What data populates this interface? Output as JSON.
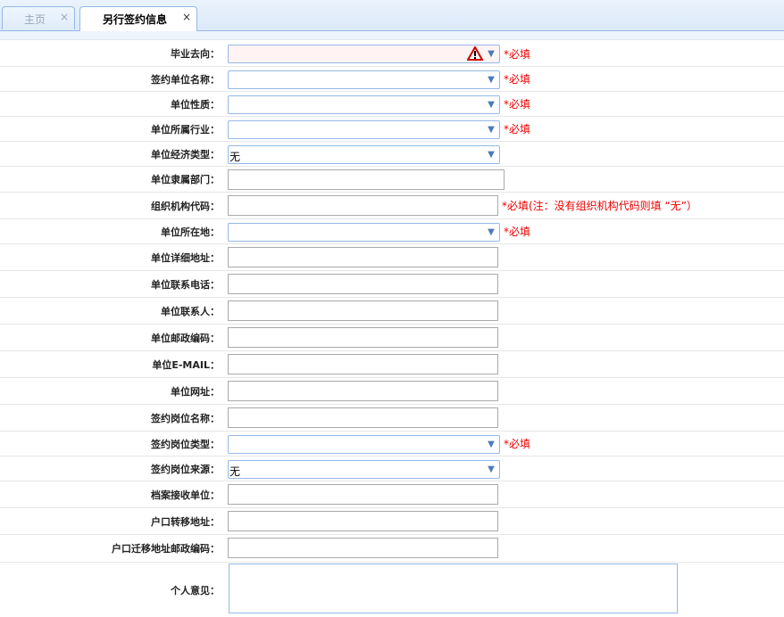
{
  "tabs": [
    {
      "label": "主页",
      "close": "×"
    },
    {
      "label": "另行签约信息",
      "close": "×"
    }
  ],
  "required_text": "*必填",
  "org_code_note": "*必填(注：没有组织机构代码则填 “无”）",
  "fields": {
    "destination": {
      "label": "毕业去向："
    },
    "company_name": {
      "label": "签约单位名称："
    },
    "company_nature": {
      "label": "单位性质："
    },
    "industry": {
      "label": "单位所属行业："
    },
    "economic_type": {
      "label": "单位经济类型：",
      "value": "无"
    },
    "affiliation": {
      "label": "单位隶属部门："
    },
    "org_code": {
      "label": "组织机构代码："
    },
    "location": {
      "label": "单位所在地："
    },
    "address": {
      "label": "单位详细地址："
    },
    "phone": {
      "label": "单位联系电话："
    },
    "contact": {
      "label": "单位联系人："
    },
    "postcode": {
      "label": "单位邮政编码："
    },
    "email": {
      "label": "单位E-MAIL："
    },
    "website": {
      "label": "单位网址："
    },
    "job_name": {
      "label": "签约岗位名称："
    },
    "job_type": {
      "label": "签约岗位类型："
    },
    "job_source": {
      "label": "签约岗位来源：",
      "value": "无"
    },
    "archive_unit": {
      "label": "档案接收单位："
    },
    "hukou_address": {
      "label": "户口转移地址："
    },
    "hukou_postcode": {
      "label": "户口迁移地址邮政编码："
    },
    "opinion": {
      "label": "个人意见："
    }
  }
}
